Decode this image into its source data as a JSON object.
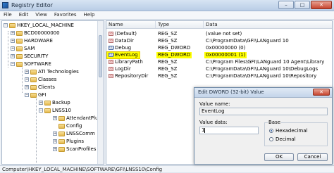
{
  "window": {
    "title": "Registry Editor",
    "min": "–",
    "max": "□",
    "close": "✕"
  },
  "menu": [
    "File",
    "Edit",
    "View",
    "Favorites",
    "Help"
  ],
  "tree": [
    {
      "label": "HKEY_LOCAL_MACHINE",
      "expander": "−"
    },
    {
      "label": "BCD00000000",
      "expander": "+"
    },
    {
      "label": "HARDWARE",
      "expander": "+"
    },
    {
      "label": "SAM",
      "expander": "+"
    },
    {
      "label": "SECURITY",
      "expander": "+"
    },
    {
      "label": "SOFTWARE",
      "expander": "−"
    },
    {
      "label": "ATI Technologies",
      "expander": "+"
    },
    {
      "label": "Classes",
      "expander": "+"
    },
    {
      "label": "Clients",
      "expander": "+"
    },
    {
      "label": "GFI",
      "expander": "−"
    },
    {
      "label": "Backup",
      "expander": "+"
    },
    {
      "label": "LNSS10",
      "expander": "−"
    },
    {
      "label": "AttendantPlugins",
      "expander": "+"
    },
    {
      "label": "Config",
      "expander": ""
    },
    {
      "label": "LNSSComm",
      "expander": "+"
    },
    {
      "label": "Plugins",
      "expander": "+"
    },
    {
      "label": "ScanProfiles",
      "expander": "+"
    }
  ],
  "list": {
    "headers": {
      "name": "Name",
      "type": "Type",
      "data": "Data"
    },
    "rows": [
      {
        "name": "(Default)",
        "type": "REG_SZ",
        "data": "(value not set)",
        "icon": "ab"
      },
      {
        "name": "DataDir",
        "type": "REG_SZ",
        "data": "C:\\ProgramData\\GFI\\LANguard 10",
        "icon": "ab"
      },
      {
        "name": "Debug",
        "type": "REG_DWORD",
        "data": "0x00000000 (0)",
        "icon": "011"
      },
      {
        "name": "EventLog",
        "type": "REG_DWORD",
        "data": "0x00000001 (1)",
        "icon": "011"
      },
      {
        "name": "LibraryPath",
        "type": "REG_SZ",
        "data": "C:\\Program Files\\GFI\\LANguard 10 Agent\\Library",
        "icon": "ab"
      },
      {
        "name": "LogDir",
        "type": "REG_SZ",
        "data": "C:\\ProgramData\\GFI\\LANguard 10\\DebugLogs",
        "icon": "ab"
      },
      {
        "name": "RepositoryDir",
        "type": "REG_SZ",
        "data": "C:\\ProgramData\\GFI\\LANguard 10\\Repository",
        "icon": "ab"
      }
    ]
  },
  "status": "Computer\\HKEY_LOCAL_MACHINE\\SOFTWARE\\GFI\\LNSS10\\Config",
  "dialog": {
    "title": "Edit DWORD (32-bit) Value",
    "close": "✕",
    "value_name_label": "Value name:",
    "value_name": "EventLog",
    "value_data_label": "Value data:",
    "value_data": "1",
    "base_label": "Base",
    "hex_label": "Hexadecimal",
    "dec_label": "Decimal",
    "ok": "OK",
    "cancel": "Cancel"
  }
}
